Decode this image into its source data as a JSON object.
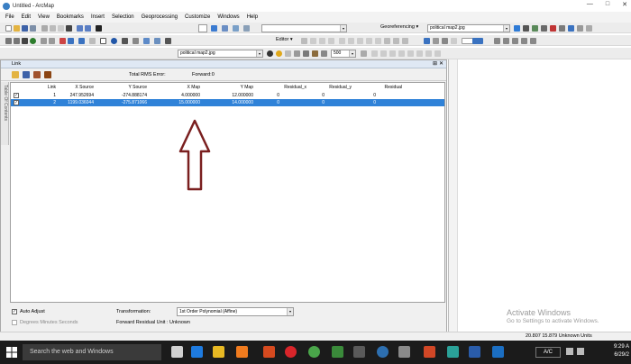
{
  "window": {
    "title": "Untitled - ArcMap",
    "controls": [
      "—",
      "□",
      "✕"
    ]
  },
  "menu": [
    "File",
    "Edit",
    "View",
    "Bookmarks",
    "Insert",
    "Selection",
    "Geoprocessing",
    "Customize",
    "Windows",
    "Help"
  ],
  "toolbar1": {
    "scale_value": "",
    "georef_label": "Georeferencing ▾",
    "georef_layer": "political map2.jpg"
  },
  "toolbar2": {
    "editor_label": "Editor ▾"
  },
  "toolbar3": {
    "layer_value": "political map2.jpg",
    "percent_value": "500"
  },
  "link_panel": {
    "title": "Link",
    "total_rms_label": "Total RMS Error:",
    "forward_label": "Forward:0",
    "columns": [
      "Link",
      "X Source",
      "Y Source",
      "X Map",
      "Y Map",
      "Residual_x",
      "Residual_y",
      "Residual"
    ],
    "rows": [
      {
        "link": "1",
        "x_source": "247.952694",
        "y_source": "-274.888174",
        "x_map": "4.000000",
        "y_map": "12.000000",
        "res_x": "0",
        "res_y": "0",
        "res": "0",
        "checked": true,
        "selected": false
      },
      {
        "link": "2",
        "x_source": "1199.036044",
        "y_source": "-275.871066",
        "x_map": "15.000000",
        "y_map": "14.000000",
        "res_x": "0",
        "res_y": "0",
        "res": "0",
        "checked": true,
        "selected": true
      }
    ],
    "side_tab": "Table Of Contents",
    "auto_adjust_label": "Auto Adjust",
    "transformation_label": "Transformation:",
    "transformation_value": "1st Order Polynomial (Affine)",
    "degrees_label": "Degrees Minutes Seconds",
    "forward_residual_label": "Forward Residual Unit : Unknown"
  },
  "watermark": {
    "line1": "Activate Windows",
    "line2": "Go to Settings to activate Windows."
  },
  "status": {
    "coords": "20.807  15.879 Unknown Units"
  },
  "taskbar": {
    "search_placeholder": "Search the web and Windows",
    "time": "9:29 A",
    "date": "6/29/2",
    "lang": "A/C"
  },
  "colors": {
    "selection": "#2f82d8",
    "arrow": "#7a1f1f",
    "taskbar": "#1b1b1b"
  }
}
